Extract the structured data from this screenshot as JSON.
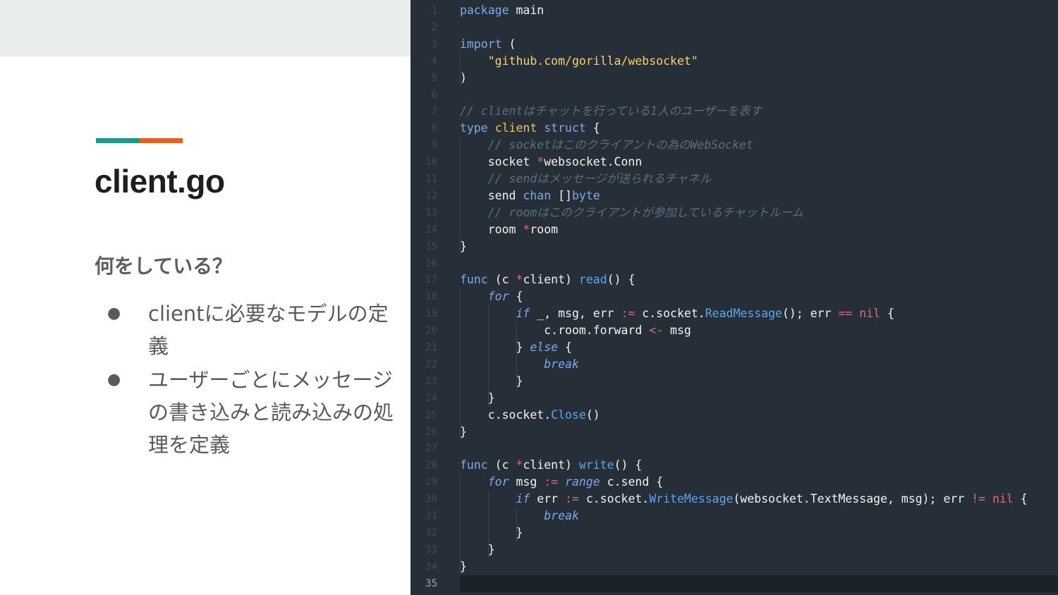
{
  "slide": {
    "title": "client.go",
    "subheading": "何をしている？",
    "bullets": [
      {
        "marker": "●",
        "text": "clientに必要なモデルの定義"
      },
      {
        "marker": "●",
        "text": "ユーザーごとにメッセージの書き込みと読み込みの処理を定義"
      }
    ],
    "accent_colors": [
      "#1e9a8a",
      "#e4611a"
    ]
  },
  "editor": {
    "current_line": 35,
    "line_numbers": [
      "1",
      "2",
      "3",
      "4",
      "5",
      "6",
      "7",
      "8",
      "9",
      "10",
      "11",
      "12",
      "13",
      "14",
      "15",
      "16",
      "17",
      "18",
      "19",
      "20",
      "21",
      "22",
      "23",
      "24",
      "25",
      "26",
      "27",
      "28",
      "29",
      "30",
      "31",
      "32",
      "33",
      "34",
      "35"
    ],
    "lines": [
      [
        [
          "kw",
          "package"
        ],
        [
          "pl",
          " main"
        ]
      ],
      [],
      [
        [
          "kw",
          "import"
        ],
        [
          "pl",
          " ("
        ]
      ],
      [
        [
          "pl",
          "    "
        ],
        [
          "str",
          "\"github.com/gorilla/websocket\""
        ]
      ],
      [
        [
          "pl",
          ")"
        ]
      ],
      [],
      [
        [
          "cmt",
          "// clientはチャットを行っている1人のユーザーを表す"
        ]
      ],
      [
        [
          "kw",
          "type"
        ],
        [
          "pl",
          " "
        ],
        [
          "typ",
          "client"
        ],
        [
          "pl",
          " "
        ],
        [
          "kw",
          "struct"
        ],
        [
          "pl",
          " {"
        ]
      ],
      [
        [
          "pl",
          "    "
        ],
        [
          "cmt",
          "// socketはこのクライアントの為のWebSocket"
        ]
      ],
      [
        [
          "pl",
          "    socket "
        ],
        [
          "op",
          "*"
        ],
        [
          "pl",
          "websocket.Conn"
        ]
      ],
      [
        [
          "pl",
          "    "
        ],
        [
          "cmt",
          "// sendはメッセージが送られるチャネル"
        ]
      ],
      [
        [
          "pl",
          "    send "
        ],
        [
          "kw",
          "chan"
        ],
        [
          "pl",
          " []"
        ],
        [
          "kw",
          "byte"
        ]
      ],
      [
        [
          "pl",
          "    "
        ],
        [
          "cmt",
          "// roomはこのクライアントが参加しているチャットルーム"
        ]
      ],
      [
        [
          "pl",
          "    room "
        ],
        [
          "op",
          "*"
        ],
        [
          "pl",
          "room"
        ]
      ],
      [
        [
          "pl",
          "}"
        ]
      ],
      [],
      [
        [
          "kw",
          "func"
        ],
        [
          "pl",
          " (c "
        ],
        [
          "op",
          "*"
        ],
        [
          "pl",
          "client) "
        ],
        [
          "fn",
          "read"
        ],
        [
          "pl",
          "() {"
        ]
      ],
      [
        [
          "pl",
          "    "
        ],
        [
          "kwi",
          "for"
        ],
        [
          "pl",
          " {"
        ]
      ],
      [
        [
          "pl",
          "        "
        ],
        [
          "kwi",
          "if"
        ],
        [
          "pl",
          " _, msg, err "
        ],
        [
          "op",
          ":="
        ],
        [
          "pl",
          " c.socket."
        ],
        [
          "fn",
          "ReadMessage"
        ],
        [
          "pl",
          "(); err "
        ],
        [
          "op",
          "=="
        ],
        [
          "pl",
          " "
        ],
        [
          "nil",
          "nil"
        ],
        [
          "pl",
          " {"
        ]
      ],
      [
        [
          "pl",
          "            c.room.forward "
        ],
        [
          "op",
          "<-"
        ],
        [
          "pl",
          " msg"
        ]
      ],
      [
        [
          "pl",
          "        } "
        ],
        [
          "kwi",
          "else"
        ],
        [
          "pl",
          " {"
        ]
      ],
      [
        [
          "pl",
          "            "
        ],
        [
          "kwi",
          "break"
        ]
      ],
      [
        [
          "pl",
          "        }"
        ]
      ],
      [
        [
          "pl",
          "    }"
        ]
      ],
      [
        [
          "pl",
          "    c.socket."
        ],
        [
          "fn",
          "Close"
        ],
        [
          "pl",
          "()"
        ]
      ],
      [
        [
          "pl",
          "}"
        ]
      ],
      [],
      [
        [
          "kw",
          "func"
        ],
        [
          "pl",
          " (c "
        ],
        [
          "op",
          "*"
        ],
        [
          "pl",
          "client) "
        ],
        [
          "fn",
          "write"
        ],
        [
          "pl",
          "() {"
        ]
      ],
      [
        [
          "pl",
          "    "
        ],
        [
          "kwi",
          "for"
        ],
        [
          "pl",
          " msg "
        ],
        [
          "op",
          ":="
        ],
        [
          "pl",
          " "
        ],
        [
          "kwi",
          "range"
        ],
        [
          "pl",
          " c.send {"
        ]
      ],
      [
        [
          "pl",
          "        "
        ],
        [
          "kwi",
          "if"
        ],
        [
          "pl",
          " err "
        ],
        [
          "op",
          ":="
        ],
        [
          "pl",
          " c.socket."
        ],
        [
          "fn",
          "WriteMessage"
        ],
        [
          "pl",
          "(websocket.TextMessage, msg); err "
        ],
        [
          "op",
          "!="
        ],
        [
          "pl",
          " "
        ],
        [
          "nil",
          "nil"
        ],
        [
          "pl",
          " {"
        ]
      ],
      [
        [
          "pl",
          "            "
        ],
        [
          "kwi",
          "break"
        ]
      ],
      [
        [
          "pl",
          "        }"
        ]
      ],
      [
        [
          "pl",
          "    }"
        ]
      ],
      [
        [
          "pl",
          "}"
        ]
      ],
      []
    ]
  }
}
